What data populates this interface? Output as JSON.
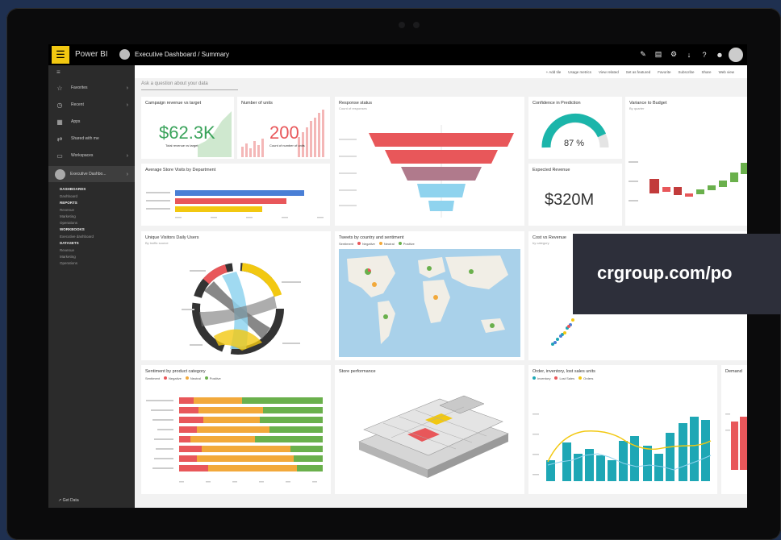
{
  "app": {
    "name": "Power BI",
    "breadcrumb": "Executive Dashboard  /  Summary",
    "top_icons": [
      "pencil-icon",
      "chat-icon",
      "gear-icon",
      "download-icon",
      "help-icon",
      "smiley-icon",
      "user-avatar"
    ]
  },
  "sidebar": {
    "items": [
      {
        "label": "Favorites",
        "icon": "star-icon"
      },
      {
        "label": "Recent",
        "icon": "clock-icon"
      },
      {
        "label": "Apps",
        "icon": "apps-icon"
      },
      {
        "label": "Shared with me",
        "icon": "share-icon"
      },
      {
        "label": "Workspaces",
        "icon": "workspace-icon"
      }
    ],
    "workspace": "Executive Dashbo...",
    "subnav": [
      {
        "text": "DASHBOARDS",
        "head": true
      },
      {
        "text": "Dashboard",
        "head": false
      },
      {
        "text": "REPORTS",
        "head": true
      },
      {
        "text": "Revenue",
        "head": false
      },
      {
        "text": "Marketing",
        "head": false
      },
      {
        "text": "Operations",
        "head": false
      },
      {
        "text": "WORKBOOKS",
        "head": true
      },
      {
        "text": "Executive dashboard",
        "head": false
      },
      {
        "text": "DATASETS",
        "head": true
      },
      {
        "text": "Revenue",
        "head": false
      },
      {
        "text": "Marketing",
        "head": false
      },
      {
        "text": "Operations",
        "head": false
      }
    ],
    "footer": "Get Data"
  },
  "toolbar": [
    "+ Add tile",
    "Usage metrics",
    "View related",
    "Set as featured",
    "Favorite",
    "Subscribe",
    "Share",
    "Web view"
  ],
  "qa_placeholder": "Ask a question about your data",
  "tiles": {
    "campaign": {
      "title": "Campaign revenue vs target",
      "value": "$62.3K",
      "label": "Total revenue vs target"
    },
    "units": {
      "title": "Number of units",
      "value": "200",
      "label": "Count of number of units"
    },
    "response": {
      "title": "Response status",
      "sub": "Count of responses"
    },
    "confidence": {
      "title": "Confidence in Prediction",
      "value": "87 %"
    },
    "variance": {
      "title": "Variance to Budget",
      "sub": "By quarter"
    },
    "avg_store": {
      "title": "Average Store Visits by Department"
    },
    "expected": {
      "title": "Expected Revenue",
      "value": "$320M"
    },
    "unique_visitors": {
      "title": "Unique Visitors Daily Users",
      "sub": "By traffic source"
    },
    "tweets": {
      "title": "Tweets by country and sentiment",
      "legend_label": "Sentiment",
      "legend": [
        "Negative",
        "Neutral",
        "Positive"
      ]
    },
    "cost": {
      "title": "Cost vs Revenue",
      "sub": "by category"
    },
    "sentiment": {
      "title": "Sentiment by product category",
      "legend_label": "Sentiment",
      "legend": [
        "Negative",
        "Neutral",
        "Positive"
      ]
    },
    "store_perf": {
      "title": "Store performance"
    },
    "orders": {
      "title": "Order, inventory, lost sales units",
      "legend": [
        "Inventory",
        "Lost Sales",
        "Orders"
      ]
    },
    "demand": {
      "title": "Demand"
    }
  },
  "banner": {
    "text": "crgroup.com/po"
  },
  "colors": {
    "red": "#e8575a",
    "yellow": "#f2c811",
    "green": "#6ab04c",
    "teal": "#1ea7b5",
    "blue": "#4a7fd6",
    "orange": "#f2a93b"
  }
}
